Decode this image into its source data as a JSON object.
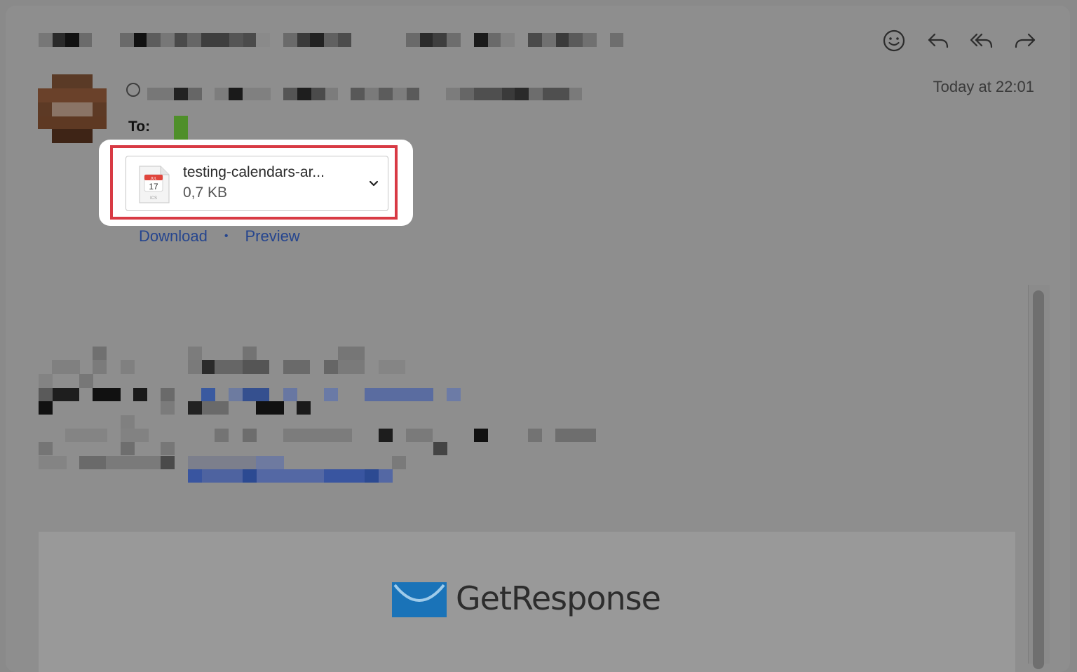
{
  "header": {
    "timestamp": "Today at 22:01",
    "to_label": "To:"
  },
  "toolbar": {
    "icons": [
      "smiley-icon",
      "reply-icon",
      "reply-all-icon",
      "forward-icon"
    ]
  },
  "attachment": {
    "icon_day": "17",
    "icon_month": "JUL",
    "icon_ext": "ICS",
    "file_name": "testing-calendars-ar...",
    "file_size": "0,7 KB",
    "download_label": "Download",
    "separator": "•",
    "preview_label": "Preview"
  },
  "banner": {
    "brand_name": "GetResponse",
    "brand_color": "#1a73b8"
  },
  "colors": {
    "highlight_border": "#d83a44",
    "link": "#25458e"
  }
}
